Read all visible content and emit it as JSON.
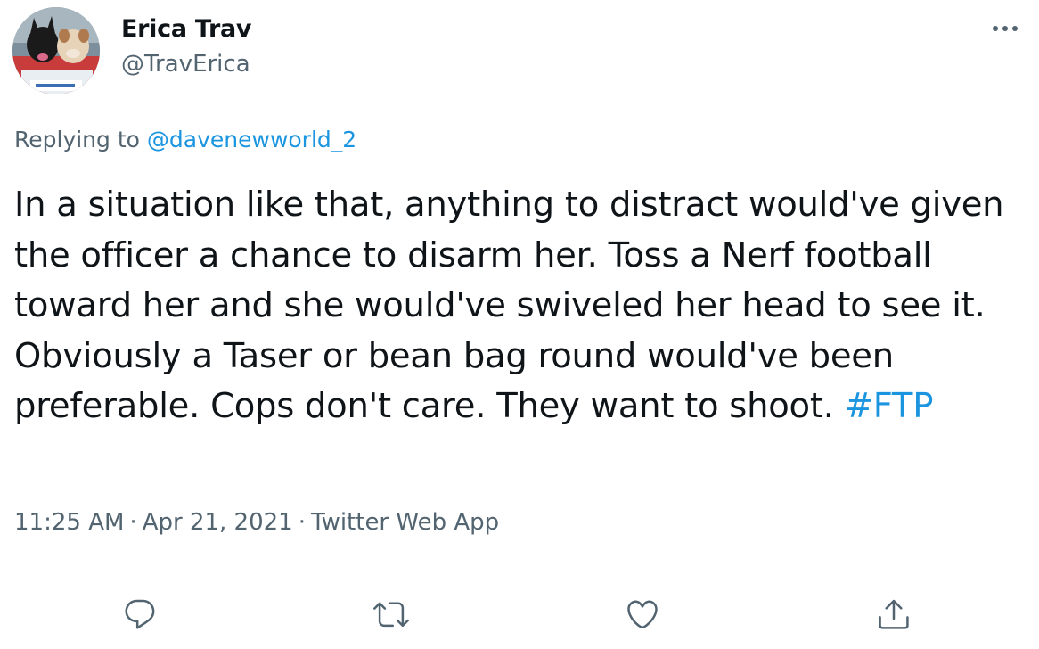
{
  "author": {
    "display_name": "Erica Trav",
    "handle": "@TravErica"
  },
  "reply": {
    "prefix": "Replying to",
    "mention": "@davenewworld_2"
  },
  "tweet": {
    "text": "In a situation like that, anything to distract would've given the officer a chance to disarm her. Toss a Nerf football toward her and she would've swiveled her head to see it. Obviously a Taser or bean bag round would've been preferable. Cops don't care. They want to shoot.",
    "hashtag": "#FTP"
  },
  "meta": {
    "time": "11:25 AM",
    "date": "Apr 21, 2021",
    "source": "Twitter Web App",
    "separator": "·"
  },
  "icons": {
    "more": "more-horizontal-icon",
    "reply": "reply-icon",
    "retweet": "retweet-icon",
    "like": "like-icon",
    "share": "share-icon"
  },
  "colors": {
    "link": "#1b95e0",
    "secondary_text": "#536471",
    "primary_text": "#0f1419",
    "divider": "#dfe5ea"
  }
}
